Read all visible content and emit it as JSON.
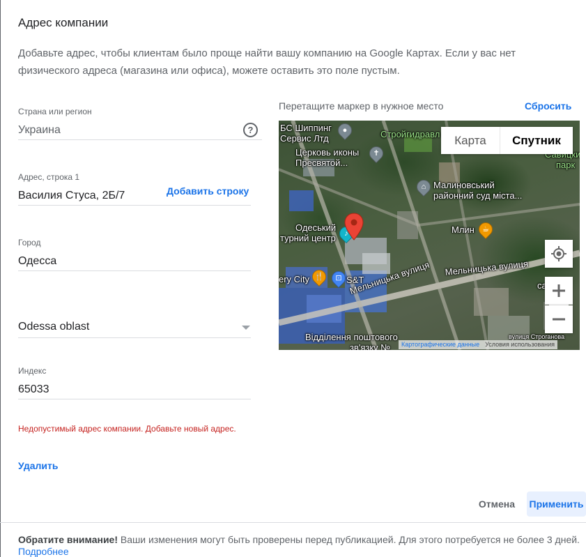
{
  "dialog": {
    "title": "Адрес компании",
    "description": "Добавьте адрес, чтобы клиентам было проще найти вашу компанию на Google Картах. Если у вас нет физического адреса (магазина или офиса), можете оставить это поле пустым."
  },
  "form": {
    "country": {
      "label": "Страна или регион",
      "value": "Украина",
      "help_icon": "?"
    },
    "address_line1": {
      "label": "Адрес, строка 1",
      "value": "Василия Стуса, 2Б/7",
      "add_line_label": "Добавить строку"
    },
    "city": {
      "label": "Город",
      "value": "Одесса"
    },
    "region": {
      "value": "Odessa oblast"
    },
    "postal_code": {
      "label": "Индекс",
      "value": "65033"
    },
    "error": "Недопустимый адрес компании. Добавьте новый адрес.",
    "delete_label": "Удалить"
  },
  "map": {
    "hint": "Перетащите маркер в нужное место",
    "reset_label": "Сбросить",
    "type_map": "Карта",
    "type_satellite": "Спутник",
    "labels": {
      "shipping_1": "БС Шиппинг",
      "shipping_2": "Сервис Лтд",
      "church_1": "Церковь иконы",
      "church_2": "Пресвятой...",
      "stroygidravlika": "Стройгидравл",
      "court_1": "Малиновський",
      "court_2": "районний суд міста...",
      "park_1": "Савицкий",
      "park_2": "парк",
      "mlyn": "Млин",
      "culture_1": "Одеський",
      "culture_2": "турний центр",
      "city": "ery City",
      "st": "S&T",
      "street_1": "Мельницька вулиця",
      "street_2": "Мельницька вулиця",
      "samkl": "са",
      "post_1": "Відділення поштового",
      "post_2": "зв'язку №",
      "stroganova": "вулиця Строганова"
    },
    "attribution": {
      "data": "Картографические данные",
      "terms": "Условия использования"
    }
  },
  "actions": {
    "cancel": "Отмена",
    "apply": "Применить"
  },
  "footer": {
    "note_bold": "Обратите внимание!",
    "note_text": " Ваши изменения могут быть проверены перед публикацией. Для этого потребуется не более 3 дней.",
    "more_link": "Подробнее"
  },
  "colors": {
    "accent": "#1a73e8",
    "error": "#c5221f",
    "marker": "#ea4335"
  }
}
